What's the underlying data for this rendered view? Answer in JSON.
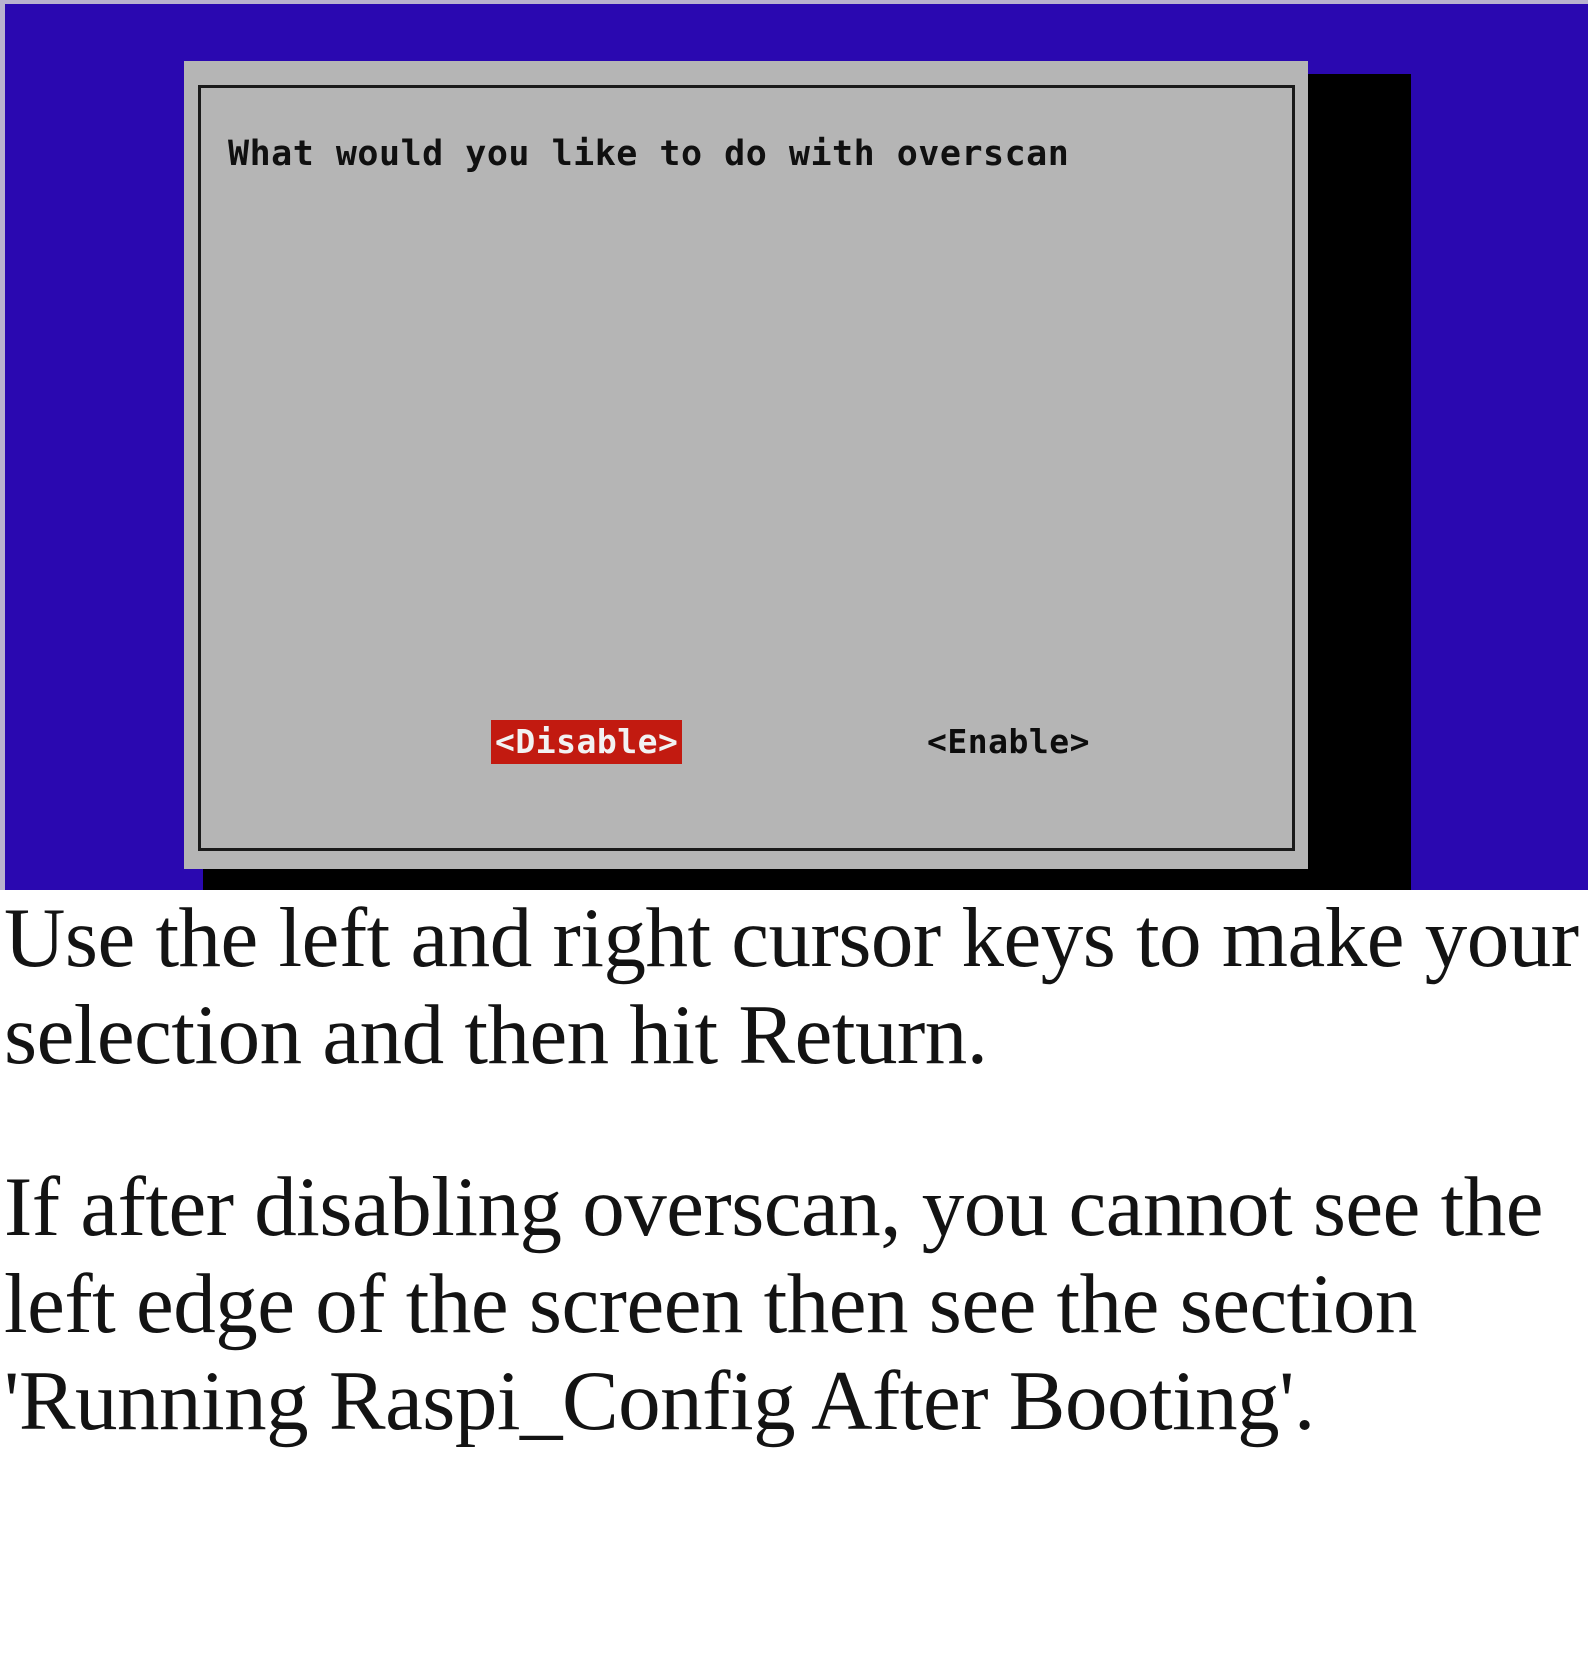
{
  "screen": {
    "background_color": "#2a08b0",
    "shadow_color": "#000000"
  },
  "dialog": {
    "background_color": "#b5b5b5",
    "border_color": "#1a1a1a",
    "title": "What would you like to do with overscan",
    "buttons": [
      {
        "label": "<Disable>",
        "state": "selected",
        "bg_color": "#c21a10",
        "fg_color": "#f2f2f2"
      },
      {
        "label": "<Enable>",
        "state": "unselected",
        "bg_color": "transparent",
        "fg_color": "#0d0d0d"
      }
    ]
  },
  "caption": {
    "paragraph_1": "Use the left and right cursor keys to make your selection and then hit Return.",
    "paragraph_2": "If after disabling overscan, you cannot see the left edge of the screen then see the section 'Running Raspi_Config After Booting'."
  }
}
